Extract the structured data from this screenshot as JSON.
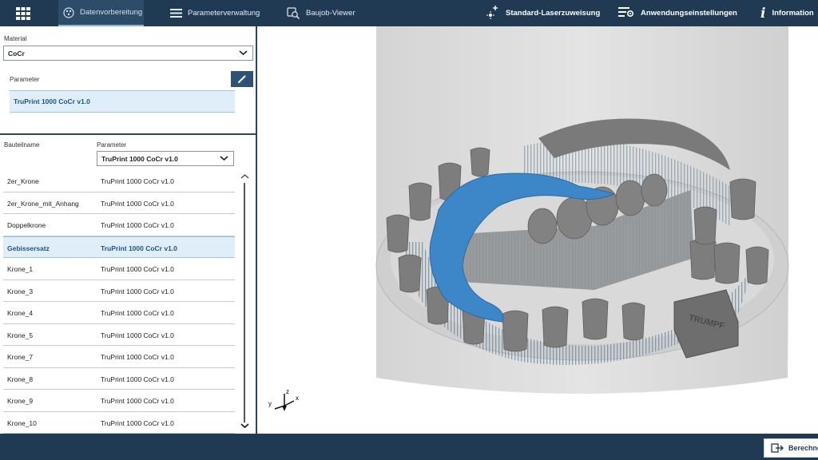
{
  "topbar": {
    "tabs": [
      {
        "label": "Datenvorbereitung",
        "icon": "workflow-icon",
        "active": true
      },
      {
        "label": "Parameterverwaltung",
        "icon": "list-icon",
        "active": false
      },
      {
        "label": "Baujob-Viewer",
        "icon": "viewer-search-icon",
        "active": false
      }
    ],
    "right": [
      {
        "label": "Standard-Laserzuweisung",
        "icon": "laser-plus-icon"
      },
      {
        "label": "Anwendungseinstellungen",
        "icon": "settings-list-icon"
      },
      {
        "label": "Information",
        "icon": "info-icon"
      }
    ]
  },
  "material": {
    "label": "Material",
    "value": "CoCr"
  },
  "parameter": {
    "label": "Parameter",
    "selected": "TruPrint 1000 CoCr v1.0"
  },
  "table": {
    "col_name": "Bauteilname",
    "col_param": "Parameter",
    "param_filter": "TruPrint 1000 CoCr v1.0",
    "rows": [
      {
        "name": "2er_Krone",
        "param": "TruPrint 1000 CoCr v1.0"
      },
      {
        "name": "2er_Krone_mit_Anhang",
        "param": "TruPrint 1000 CoCr v1.0"
      },
      {
        "name": "Doppelkrone",
        "param": "TruPrint 1000 CoCr v1.0"
      },
      {
        "name": "Gebissersatz",
        "param": "TruPrint 1000 CoCr v1.0",
        "selected": true
      },
      {
        "name": "Krone_1",
        "param": "TruPrint 1000 CoCr v1.0"
      },
      {
        "name": "Krone_3",
        "param": "TruPrint 1000 CoCr v1.0"
      },
      {
        "name": "Krone_4",
        "param": "TruPrint 1000 CoCr v1.0"
      },
      {
        "name": "Krone_5",
        "param": "TruPrint 1000 CoCr v1.0"
      },
      {
        "name": "Krone_7",
        "param": "TruPrint 1000 CoCr v1.0"
      },
      {
        "name": "Krone_8",
        "param": "TruPrint 1000 CoCr v1.0"
      },
      {
        "name": "Krone_9",
        "param": "TruPrint 1000 CoCr v1.0"
      },
      {
        "name": "Krone_10",
        "param": "TruPrint 1000 CoCr v1.0"
      }
    ]
  },
  "viewport": {
    "axes": [
      "x",
      "y",
      "z"
    ],
    "plate_text": "TRUMPF"
  },
  "bottom": {
    "calc_label": "Berechnen"
  },
  "colors": {
    "navy": "#1f3a52",
    "selection": "#dfeef9",
    "accent_blue": "#3d87c9",
    "part_gray": "#7d7d7d"
  }
}
